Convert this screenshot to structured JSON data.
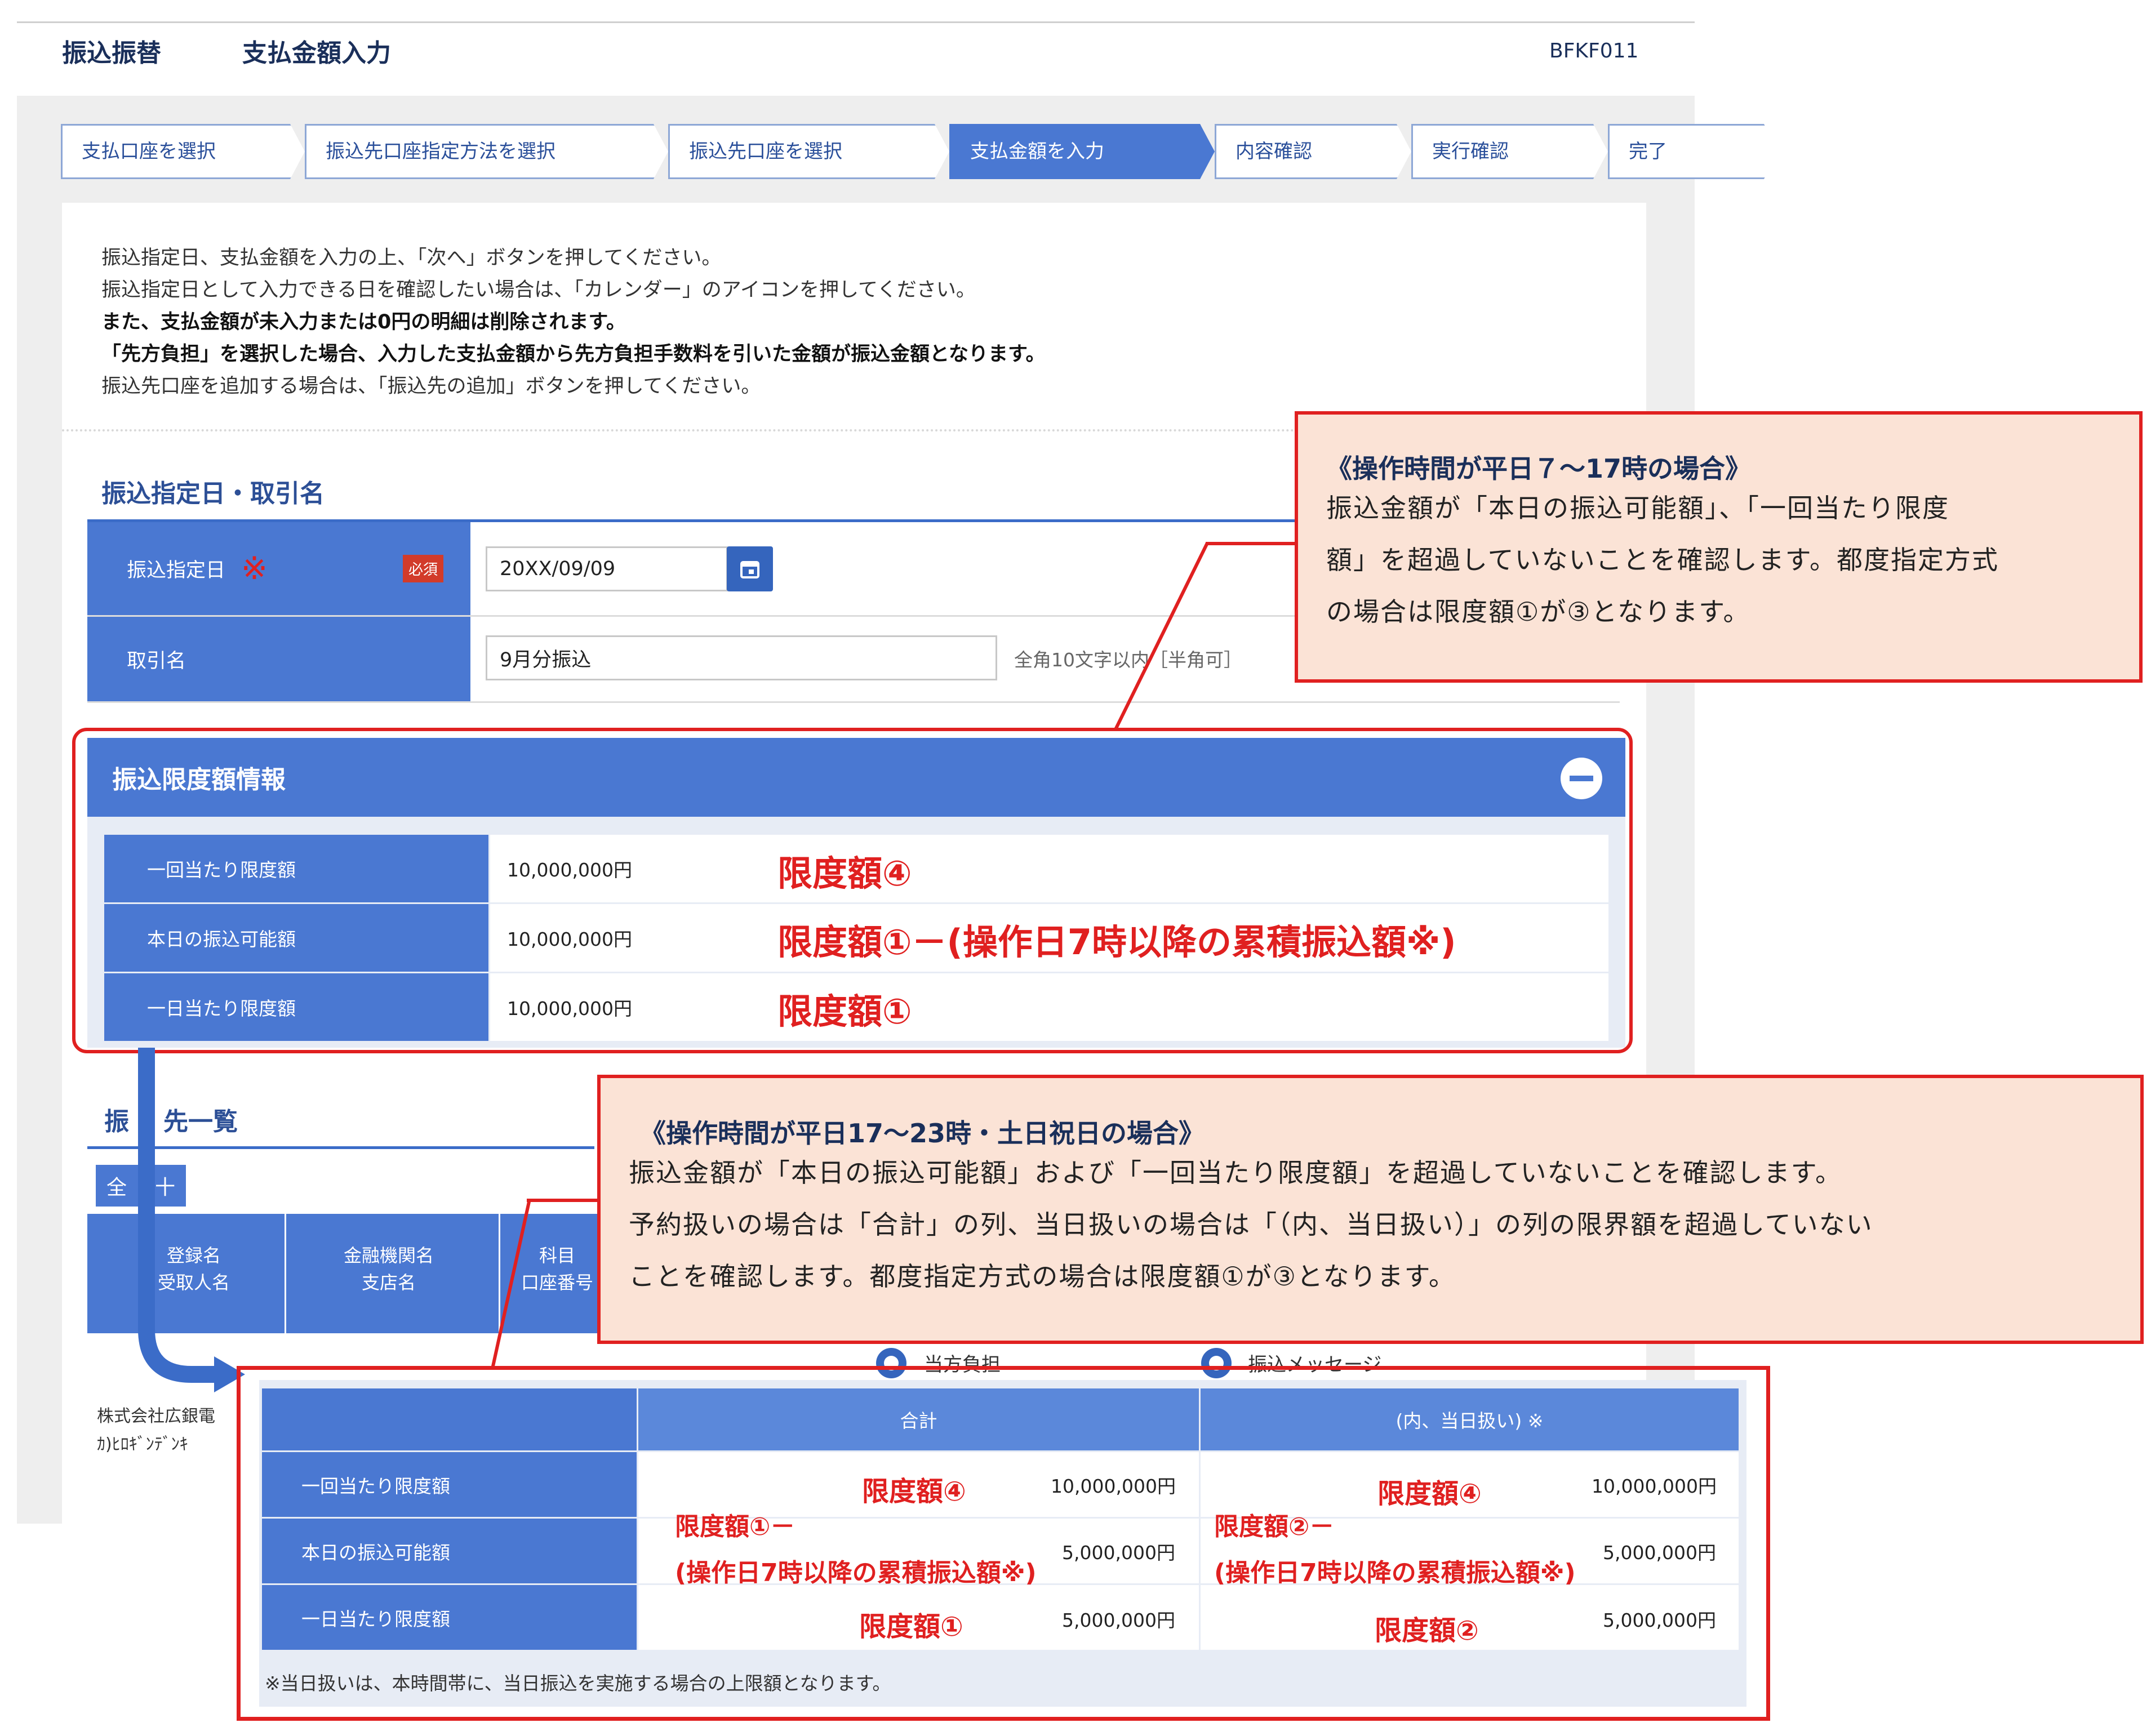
{
  "header": {
    "title_main": "振込振替",
    "title_sub": "支払金額入力",
    "screen_id": "BFKF011"
  },
  "steps": [
    "支払口座を選択",
    "振込先口座指定方法を選択",
    "振込先口座を選択",
    "支払金額を入力",
    "内容確認",
    "実行確認",
    "完了"
  ],
  "intro": {
    "line1": "振込指定日、支払金額を入力の上、「次へ」ボタンを押してください。",
    "line2": "振込指定日として入力できる日を確認したい場合は、「カレンダー」のアイコンを押してください。",
    "line3": "また、支払金額が未入力または0円の明細は削除されます。",
    "line4": "「先方負担」を選択した場合、入力した支払金額から先方負担手数料を引いた金額が振込金額となります。",
    "line5": "振込先口座を追加する場合は、「振込先の追加」ボタンを押してください。"
  },
  "transfer_section": {
    "title": "振込指定日・取引名",
    "date_label": "振込指定日",
    "date_mark": "※",
    "required_badge": "必須",
    "date_value": "20XX/09/09",
    "name_label": "取引名",
    "name_value": "9月分振込",
    "name_hint": "全角10文字以内［半角可］"
  },
  "limit_panel": {
    "title": "振込限度額情報",
    "rows": [
      {
        "label": "一回当たり限度額",
        "value": "10,000,000円",
        "annotation": "限度額④"
      },
      {
        "label": "本日の振込可能額",
        "value": "10,000,000円",
        "annotation": "限度額①－(操作日7時以降の累積振込額※)"
      },
      {
        "label": "一日当たり限度額",
        "value": "10,000,000円",
        "annotation": "限度額①"
      }
    ]
  },
  "callout_weekday": {
    "title": "《操作時間が平日７～17時の場合》",
    "line1": "振込金額が「本日の振込可能額」、「一回当たり限度",
    "line2": "額」を超過していないことを確認します。都度指定方式",
    "line3": "の場合は限度額①が③となります。"
  },
  "callout_night": {
    "title": "《操作時間が平日17～23時・土日祝日の場合》",
    "line1": "振込金額が「本日の振込可能額」および「一回当たり限度額」を超過していないことを確認します。",
    "line2": "予約扱いの場合は「合計」の列、当日扱いの場合は「（内、当日扱い）」の列の限界額を超過していない",
    "line3": "ことを確認します。都度指定方式の場合は限度額①が③となります。"
  },
  "payee_section": {
    "title_a": "振",
    "title_b": "先一覧",
    "all_btn_a": "全",
    "all_btn_b": "十",
    "col1_a": "登録名",
    "col1_b": "受取人名",
    "col2_a": "金融機関名",
    "col2_b": "支店名",
    "col3_a": "科目",
    "col3_b": "口座番号",
    "row_name_a": "株式会社広銀電",
    "row_name_b": "ｶ)ﾋﾛｷﾞﾝﾃﾞﾝｷ",
    "radio1": "当方負担",
    "radio2": "振込メッセージ"
  },
  "limit_table": {
    "head_total": "合計",
    "head_today": "(内、当日扱い) ※",
    "rows": [
      {
        "label": "一回当たり限度額",
        "total_note": "限度額④",
        "total_value": "10,000,000円",
        "today_note": "限度額④",
        "today_value": "10,000,000円"
      },
      {
        "label": "本日の振込可能額",
        "total_note_a": "限度額①－",
        "total_note_b": "(操作日7時以降の累積振込額※)",
        "total_value": "5,000,000円",
        "today_note_a": "限度額②－",
        "today_note_b": "(操作日7時以降の累積振込額※)",
        "today_value": "5,000,000円"
      },
      {
        "label": "一日当たり限度額",
        "total_note": "限度額①",
        "total_value": "5,000,000円",
        "today_note": "限度額②",
        "today_value": "5,000,000円"
      }
    ],
    "footnote": "※当日扱いは、本時間帯に、当日振込を実施する場合の上限額となります。"
  },
  "colors": {
    "accent": "#4a78d2",
    "annotation_red": "#e02020",
    "callout_bg": "#fbe3d6"
  }
}
